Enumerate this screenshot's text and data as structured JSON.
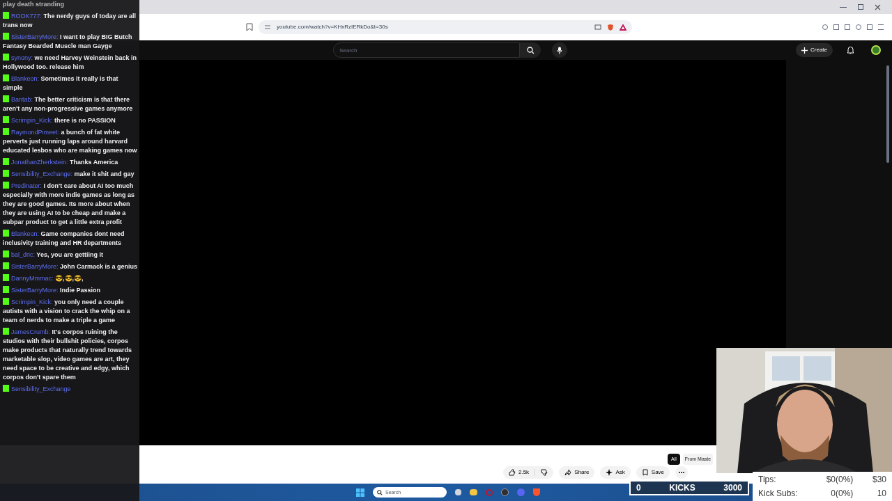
{
  "browser": {
    "url": "youtube.com/watch?v=KHxRzIERkDo&t=30s"
  },
  "youtube_header": {
    "search": {
      "placeholder": "Search"
    },
    "create_label": "Create"
  },
  "video_actions": {
    "likes": "2.5k",
    "share": "Share",
    "ask": "Ask",
    "save": "Save"
  },
  "chips": [
    {
      "label": "All",
      "selected": true
    },
    {
      "label": "From Maste",
      "selected": false
    }
  ],
  "chat": [
    {
      "text": "play death stranding"
    },
    {
      "user": "ROOK777:",
      "text": "The nerdy guys of today are all trans now"
    },
    {
      "user": "SisterBarryMore:",
      "text": "I want to play BIG Butch Fantasy Bearded Muscle man Gayge"
    },
    {
      "user": "synony:",
      "text": "we need Harvey Weinstein back in Hollywood too. release him"
    },
    {
      "user": "Blankeon:",
      "text": "Sometimes it really is that simple"
    },
    {
      "user": "Bantab:",
      "text": "The better criticism is that there aren't any non-progressive games anymore"
    },
    {
      "user": "Scrimpin_Kick:",
      "text": "there is no PASSION"
    },
    {
      "user": "RaymondPimeet:",
      "text": "a bunch of fat white perverts just running laps around harvard educated lesbos who are making games now"
    },
    {
      "user": "JonathanZherkstein:",
      "text": "Thanks America"
    },
    {
      "user": "Sensibility_Exchange:",
      "text": "make it shit and gay"
    },
    {
      "user": "Predinater:",
      "text": "I don't care about AI too much especially with more indie games as long as they are good games. Its more about when they are using AI to be cheap and make a subpar product to get a little extra profit"
    },
    {
      "user": "Blankeon:",
      "text": "Game companies dont need inclusivity training and HR departments"
    },
    {
      "user": "bal_dric:",
      "text": "Yes, you are gettiing it"
    },
    {
      "user": "SisterBarryMore:",
      "text": "John Carmack is a genius"
    },
    {
      "user": "DannyMmmac:",
      "text": "😎,😎,😎,"
    },
    {
      "user": "SisterBarryMore:",
      "text": "Indie Passion"
    },
    {
      "user": "Scrimpin_Kick:",
      "text": "you only need a couple autists with a vision to crack the whip on a team of nerds to make a triple a game"
    },
    {
      "user": "JamesCrumb:",
      "text": "It's corpos ruining the studios with their bullshit policies, corpos make products that naturally trend towards marketable slop, video games are art, they need space to be creative and edgy, which corpos don't spare them"
    },
    {
      "user": "Sensibility_Exchange"
    }
  ],
  "taskbar": {
    "search": {
      "placeholder": "Search"
    }
  },
  "kicks_goal": {
    "current": "0",
    "label": "KICKS",
    "target": "3000"
  },
  "goals": [
    {
      "label": "Tips:",
      "value": "$0(0%)",
      "target": "$30"
    },
    {
      "label": "Kick Subs:",
      "value": "0(0%)",
      "target": "10"
    }
  ]
}
